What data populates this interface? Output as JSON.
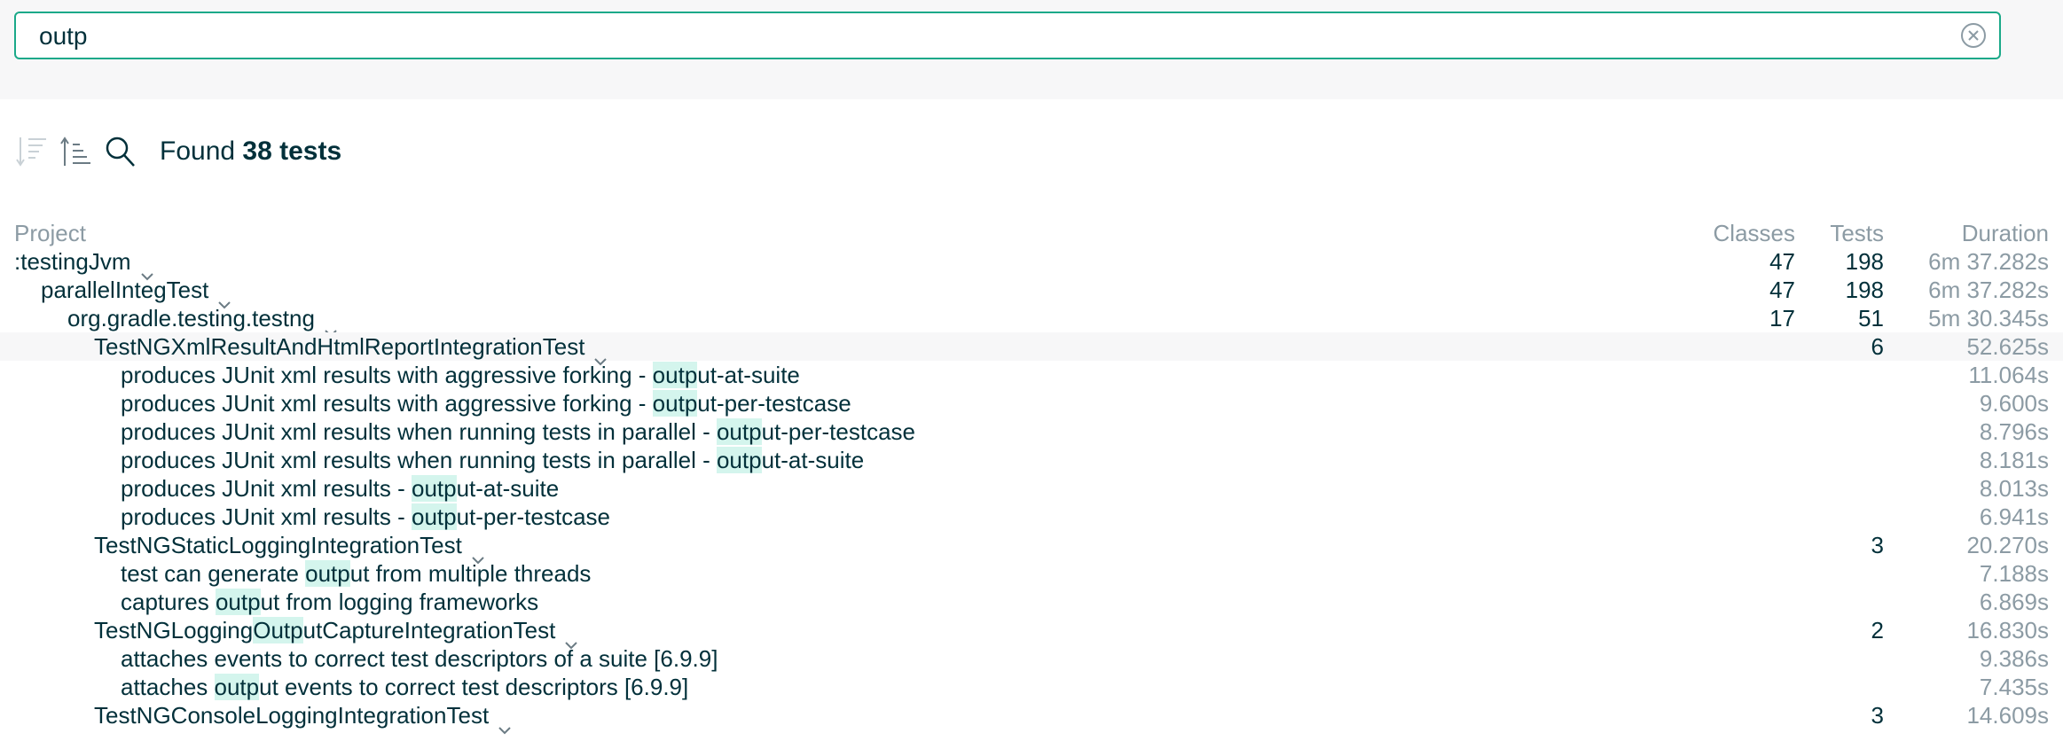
{
  "search": {
    "value": "outp",
    "placeholder": ""
  },
  "toolbar": {
    "found_prefix": "Found",
    "found_count": "38 tests"
  },
  "columns": {
    "project": "Project",
    "classes": "Classes",
    "tests": "Tests",
    "duration": "Duration"
  },
  "rows": [
    {
      "level": 0,
      "pre": ":testingJvm",
      "match": "",
      "post": "",
      "chevron": true,
      "classes": "47",
      "tests": "198",
      "duration": "6m 37.282s"
    },
    {
      "level": 1,
      "pre": "parallelIntegTest",
      "match": "",
      "post": "",
      "chevron": true,
      "classes": "47",
      "tests": "198",
      "duration": "6m 37.282s"
    },
    {
      "level": 2,
      "pre": "org.gradle.testing.testng",
      "match": "",
      "post": "",
      "chevron": true,
      "classes": "17",
      "tests": "51",
      "duration": "5m 30.345s"
    },
    {
      "level": 3,
      "pre": "TestNGXmlResultAndHtmlReportIntegrationTest",
      "match": "",
      "post": "",
      "chevron": true,
      "classes": "",
      "tests": "6",
      "duration": "52.625s",
      "highlight": true
    },
    {
      "level": 4,
      "pre": "produces JUnit xml results with aggressive forking - ",
      "match": "outp",
      "post": "ut-at-suite",
      "chevron": false,
      "classes": "",
      "tests": "",
      "duration": "11.064s"
    },
    {
      "level": 4,
      "pre": "produces JUnit xml results with aggressive forking - ",
      "match": "outp",
      "post": "ut-per-testcase",
      "chevron": false,
      "classes": "",
      "tests": "",
      "duration": "9.600s"
    },
    {
      "level": 4,
      "pre": "produces JUnit xml results when running tests in parallel - ",
      "match": "outp",
      "post": "ut-per-testcase",
      "chevron": false,
      "classes": "",
      "tests": "",
      "duration": "8.796s"
    },
    {
      "level": 4,
      "pre": "produces JUnit xml results when running tests in parallel - ",
      "match": "outp",
      "post": "ut-at-suite",
      "chevron": false,
      "classes": "",
      "tests": "",
      "duration": "8.181s"
    },
    {
      "level": 4,
      "pre": "produces JUnit xml results - ",
      "match": "outp",
      "post": "ut-at-suite",
      "chevron": false,
      "classes": "",
      "tests": "",
      "duration": "8.013s"
    },
    {
      "level": 4,
      "pre": "produces JUnit xml results - ",
      "match": "outp",
      "post": "ut-per-testcase",
      "chevron": false,
      "classes": "",
      "tests": "",
      "duration": "6.941s"
    },
    {
      "level": 3,
      "pre": "TestNGStaticLoggingIntegrationTest",
      "match": "",
      "post": "",
      "chevron": true,
      "classes": "",
      "tests": "3",
      "duration": "20.270s"
    },
    {
      "level": 4,
      "pre": "test can generate ",
      "match": "outp",
      "post": "ut from multiple threads",
      "chevron": false,
      "classes": "",
      "tests": "",
      "duration": "7.188s"
    },
    {
      "level": 4,
      "pre": "captures ",
      "match": "outp",
      "post": "ut from logging frameworks",
      "chevron": false,
      "classes": "",
      "tests": "",
      "duration": "6.869s"
    },
    {
      "level": 3,
      "pre": "TestNGLogging",
      "match": "Outp",
      "post": "utCaptureIntegrationTest",
      "chevron": true,
      "classes": "",
      "tests": "2",
      "duration": "16.830s"
    },
    {
      "level": 4,
      "pre": "attaches events to correct test descriptors of a suite [6.9.9]",
      "match": "",
      "post": "",
      "chevron": false,
      "classes": "",
      "tests": "",
      "duration": "9.386s"
    },
    {
      "level": 4,
      "pre": "attaches ",
      "match": "outp",
      "post": "ut events to correct test descriptors [6.9.9]",
      "chevron": false,
      "classes": "",
      "tests": "",
      "duration": "7.435s"
    },
    {
      "level": 3,
      "pre": "TestNGConsoleLoggingIntegrationTest",
      "match": "",
      "post": "",
      "chevron": true,
      "classes": "",
      "tests": "3",
      "duration": "14.609s"
    }
  ],
  "colors": {
    "accent": "#1ba989",
    "text": "#02303a",
    "muted": "#8c9ba4",
    "match_bg": "#d4f5ed",
    "panel_bg": "#f7f7f8"
  },
  "icons": [
    "clear-icon",
    "sort-descending-icon",
    "sort-ascending-icon",
    "search-icon",
    "chevron-down-icon"
  ]
}
